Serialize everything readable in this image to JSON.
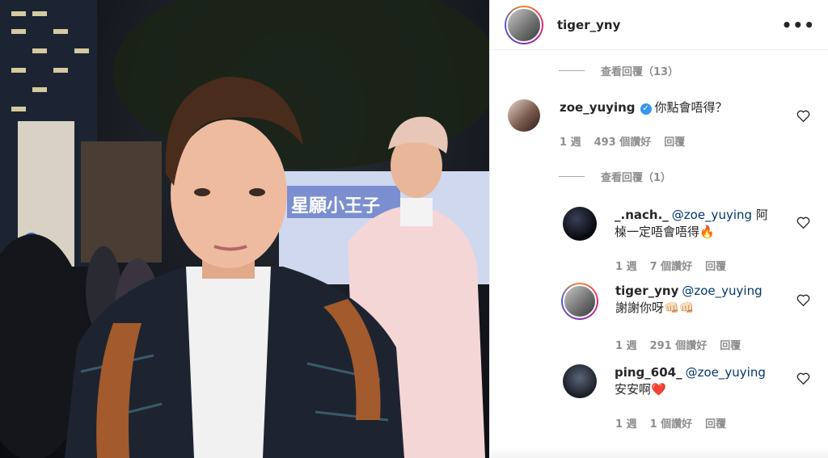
{
  "post": {
    "author": "tiger_yny",
    "more_icon": "more-horizontal-icon",
    "photo_sign_text": "星願小王子"
  },
  "top_view_replies": "查看回覆（13）",
  "main_comment": {
    "user": "zoe_yuying",
    "verified": true,
    "text": "你點會唔得？",
    "time": "1 週",
    "likes": "493 個讚好",
    "reply": "回覆"
  },
  "replies_toggle": "查看回覆（1）",
  "replies": [
    {
      "user": "_.nach._",
      "mention": "@zoe_yuying",
      "text_line1": "阿",
      "text_line2": "槕一定唔會唔得🔥",
      "time": "1 週",
      "likes": "7 個讚好",
      "reply": "回覆"
    },
    {
      "user": "tiger_yny",
      "mention": "@zoe_yuying",
      "text_line2": "謝謝你呀👊🏻👊🏻",
      "time": "1 週",
      "likes": "291 個讚好",
      "reply": "回覆"
    },
    {
      "user": "ping_604_",
      "mention": "@zoe_yuying",
      "text_line2": "安安啊❤️",
      "time": "1 週",
      "likes": "1 個讚好",
      "reply": "回覆"
    }
  ],
  "colors": {
    "verified": "#3897f0",
    "mention": "#00376b",
    "muted": "#8e8e8e"
  }
}
